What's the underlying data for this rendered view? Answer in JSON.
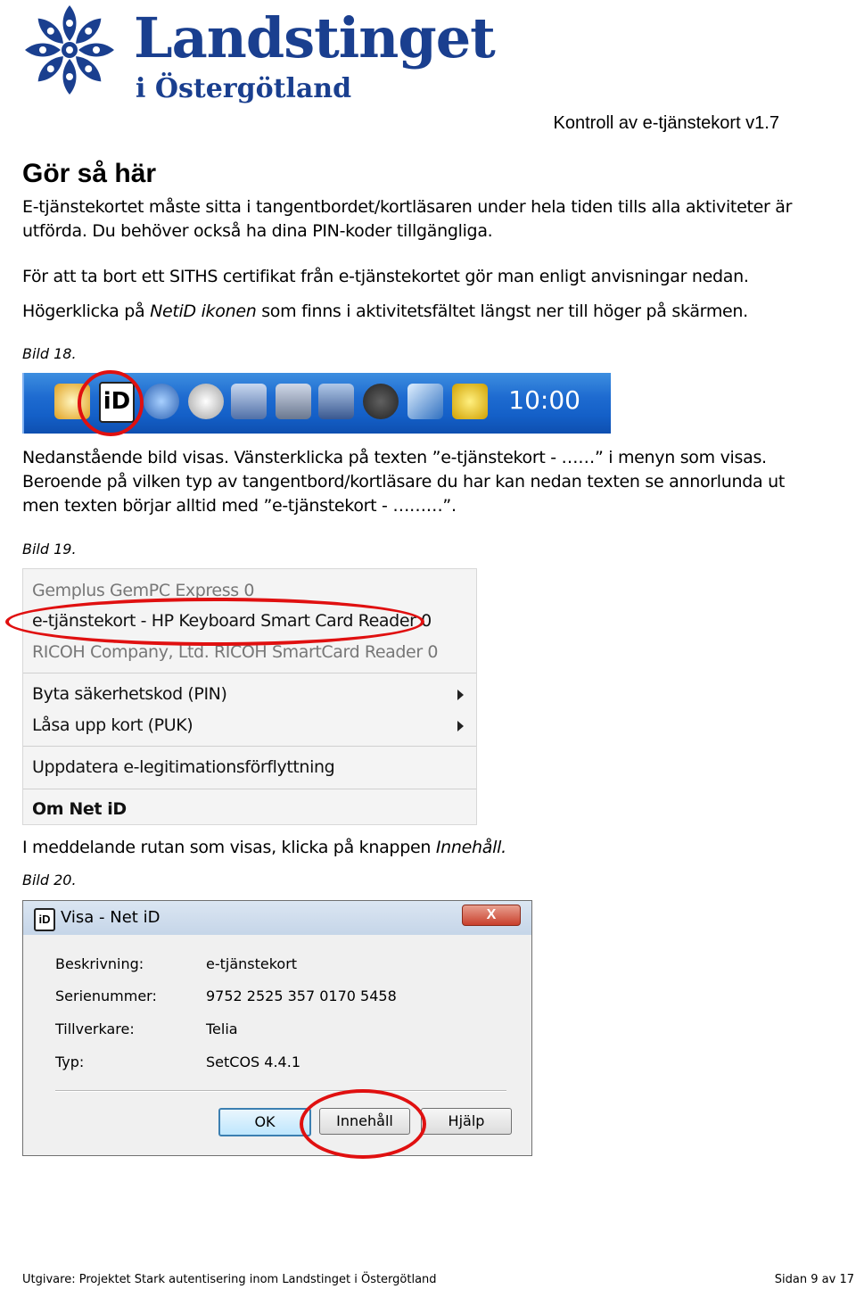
{
  "header": {
    "logo_name": "Landstinget",
    "logo_sub": "i Östergötland",
    "doc_title": "Kontroll av e-tjänstekort v1.7"
  },
  "section_title": "Gör så här",
  "paragraphs": {
    "p1": "E-tjänstekortet måste sitta i tangentbordet/kortläsaren under hela tiden tills alla aktiviteter är utförda. Du behöver också ha dina PIN-koder tillgängliga.",
    "p2": "För att ta bort ett SITHS certifikat från e-tjänstekortet gör man enligt anvisningar nedan.",
    "p3_a": "Högerklicka på ",
    "p3_em": "NetiD ikonen",
    "p3_b": " som finns i aktivitetsfältet längst ner till höger på skärmen.",
    "p4": "Nedanstående bild visas. Vänsterklicka på texten ”e-tjänstekort - ……” i menyn som visas. Beroende på vilken typ av tangentbord/kortläsare du har kan nedan texten se annorlunda ut men texten börjar alltid med ”e-tjänstekort - ………”.",
    "p5_a": "I meddelande rutan som visas, klicka på knappen ",
    "p5_em": "Innehåll."
  },
  "captions": {
    "bild18": "Bild 18.",
    "bild19": "Bild 19.",
    "bild20": "Bild 20."
  },
  "taskbar": {
    "time": "10:00",
    "netid_icon_text": "iD"
  },
  "context_menu": {
    "items": [
      "Gemplus GemPC Express 0",
      "e-tjänstekort - HP Keyboard Smart Card Reader 0",
      "RICOH Company, Ltd. RICOH SmartCard Reader 0",
      "Byta säkerhetskod (PIN)",
      "Låsa upp kort (PUK)",
      "Uppdatera e-legitimationsförflyttning",
      "Om Net iD"
    ]
  },
  "dialog": {
    "title": "Visa - Net iD",
    "icon_text": "iD",
    "close_label": "X",
    "fields": [
      {
        "label": "Beskrivning:",
        "value": "e-tjänstekort"
      },
      {
        "label": "Serienummer:",
        "value": "9752 2525 357 0170 5458"
      },
      {
        "label": "Tillverkare:",
        "value": "Telia"
      },
      {
        "label": "Typ:",
        "value": "SetCOS 4.4.1"
      }
    ],
    "buttons": {
      "ok": "OK",
      "contents": "Innehåll",
      "help": "Hjälp"
    }
  },
  "footer": {
    "left": "Utgivare: Projektet Stark autentisering inom Landstinget i Östergötland",
    "right": "Sidan 9 av 17"
  },
  "colors": {
    "brand_blue": "#1a3f8f",
    "highlight_red": "#e01010",
    "taskbar_blue": "#1e6bd0"
  }
}
